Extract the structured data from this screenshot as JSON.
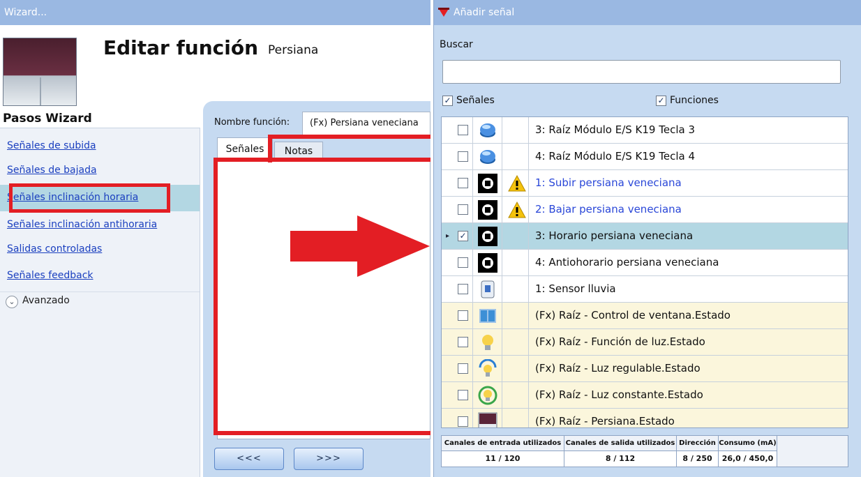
{
  "wizard": {
    "title": "Wizard...",
    "editor_title": "Editar función",
    "editor_subtitle": "Persiana",
    "steps_title": "Pasos Wizard",
    "steps": [
      "Señales de subida",
      "Señales de bajada",
      "Señales inclinación horaria",
      "Señales inclinación antihoraria",
      "Salidas controladas",
      "Señales feedback"
    ],
    "active_step": "Señales inclinación horaria",
    "advanced_label": "Avanzado",
    "function_name_label": "Nombre función:",
    "function_name_value": "(Fx) Persiana veneciana",
    "tabs": [
      "Señales",
      "Notas"
    ],
    "prev_button": "<<<",
    "next_button": ">>>"
  },
  "add_signal": {
    "title": "Añadir señal",
    "search_label": "Buscar",
    "search_value": "",
    "filters": [
      {
        "label": "Señales",
        "checked": true
      },
      {
        "label": "Funciones",
        "checked": true
      }
    ],
    "items": [
      {
        "label": "3: Raíz Módulo E/S K19 Tecla 3",
        "icon": "button-icon",
        "checked": false,
        "warning": false,
        "fx": false,
        "blue": false
      },
      {
        "label": "4: Raíz Módulo E/S K19 Tecla 4",
        "icon": "button-icon",
        "checked": false,
        "warning": false,
        "fx": false,
        "blue": false
      },
      {
        "label": "1: Subir persiana veneciana",
        "icon": "blind-input-icon",
        "checked": false,
        "warning": true,
        "fx": false,
        "blue": true
      },
      {
        "label": "2: Bajar persiana veneciana",
        "icon": "blind-input-icon",
        "checked": false,
        "warning": true,
        "fx": false,
        "blue": true
      },
      {
        "label": "3: Horario persiana veneciana",
        "icon": "blind-input-icon",
        "checked": true,
        "warning": false,
        "fx": false,
        "blue": false,
        "selected": true
      },
      {
        "label": "4: Antiohorario persiana veneciana",
        "icon": "blind-input-icon",
        "checked": false,
        "warning": false,
        "fx": false,
        "blue": false
      },
      {
        "label": "1: Sensor lluvia",
        "icon": "rain-sensor-icon",
        "checked": false,
        "warning": false,
        "fx": false,
        "blue": false
      },
      {
        "label": "(Fx) Raíz - Control de ventana.Estado",
        "icon": "window-icon",
        "checked": false,
        "warning": false,
        "fx": true,
        "blue": false
      },
      {
        "label": "(Fx) Raíz - Función de luz.Estado",
        "icon": "light-bulb-icon",
        "checked": false,
        "warning": false,
        "fx": true,
        "blue": false
      },
      {
        "label": "(Fx) Raíz - Luz regulable.Estado",
        "icon": "dimmable-light-icon",
        "checked": false,
        "warning": false,
        "fx": true,
        "blue": false
      },
      {
        "label": "(Fx) Raíz - Luz constante.Estado",
        "icon": "constant-light-icon",
        "checked": false,
        "warning": false,
        "fx": true,
        "blue": false
      },
      {
        "label": "(Fx) Raíz - Persiana.Estado",
        "icon": "blind-icon",
        "checked": false,
        "warning": false,
        "fx": true,
        "blue": false
      }
    ],
    "stats": {
      "headers": [
        "Canales de entrada utilizados",
        "Canales de salida utilizados",
        "Dirección",
        "Consumo (mA)"
      ],
      "values": [
        "11 / 120",
        "8 / 112",
        "8 / 250",
        "26,0 / 450,0"
      ]
    }
  },
  "colors": {
    "highlight": "#e31e24",
    "titlebar": "#9ab8e2",
    "panel_bg": "#c6daf1",
    "selected_row": "#b3d7e3",
    "fx_row": "#fbf6dc",
    "link": "#1a3fbf"
  }
}
